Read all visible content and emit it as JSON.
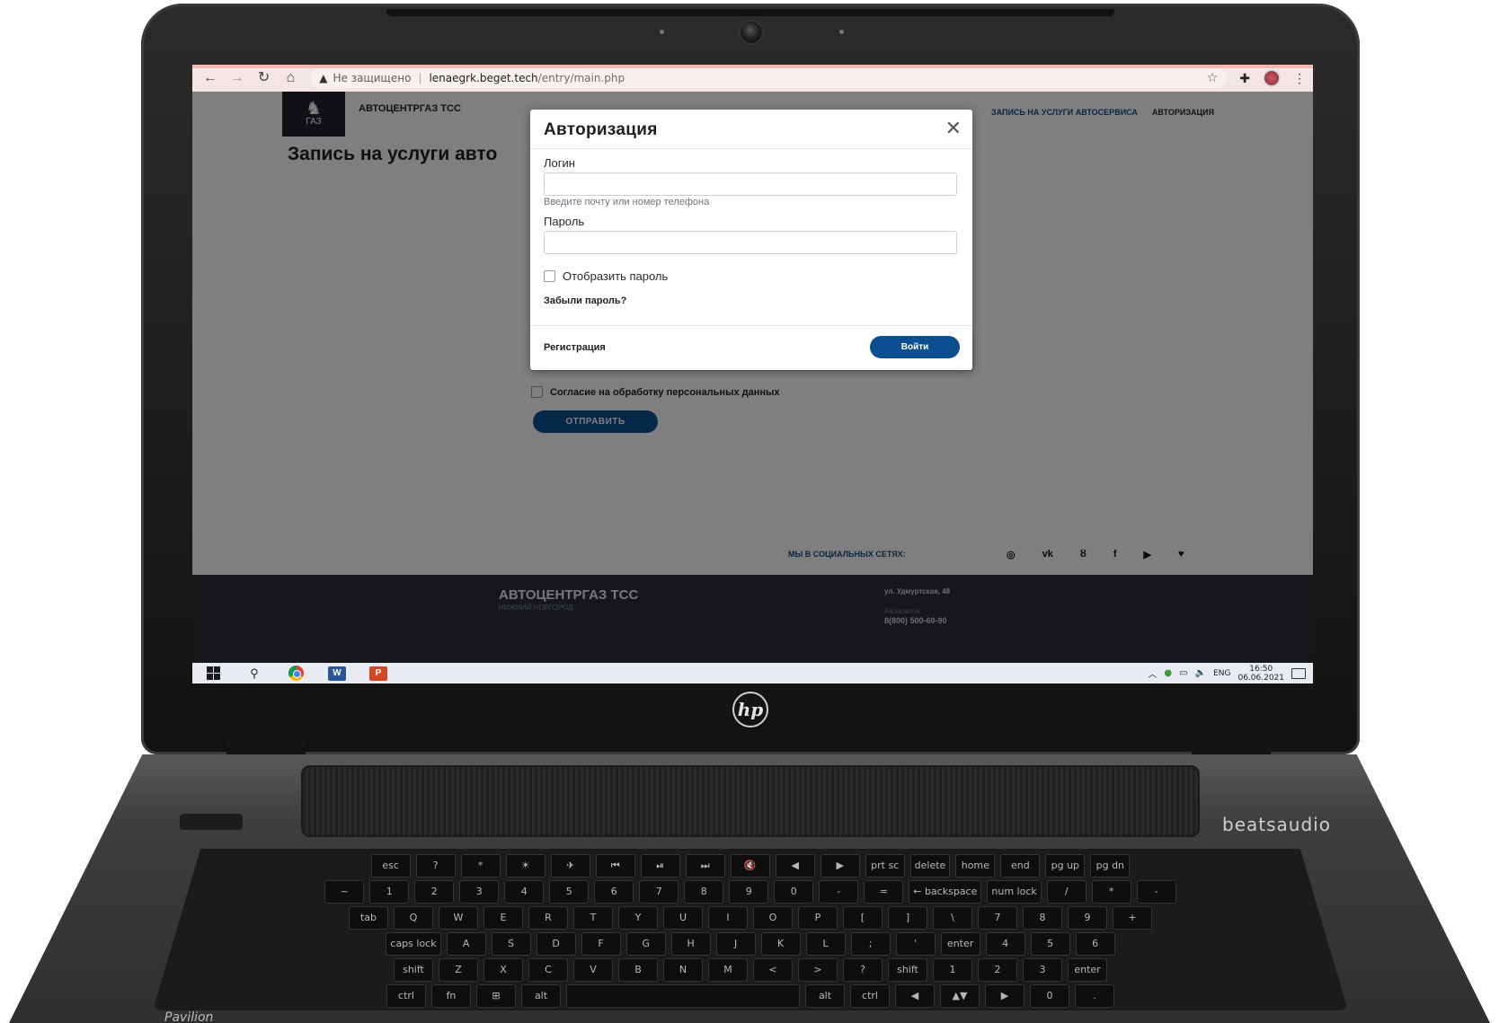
{
  "hardware": {
    "brand_logo": "hp",
    "beats_label": "beatsaudio",
    "model_label": "Pavilion",
    "keyboard_rows": [
      [
        "esc",
        "?",
        "*",
        "☀",
        "✈",
        "⏮",
        "⏯",
        "⏭",
        "🔇",
        "◀",
        "▶",
        "prt sc",
        "delete",
        "home",
        "end",
        "pg up",
        "pg dn"
      ],
      [
        "~",
        "1",
        "2",
        "3",
        "4",
        "5",
        "6",
        "7",
        "8",
        "9",
        "0",
        "-",
        "=",
        "← backspace",
        "num lock",
        "/",
        "*",
        "-"
      ],
      [
        "tab",
        "Q",
        "W",
        "E",
        "R",
        "T",
        "Y",
        "U",
        "I",
        "O",
        "P",
        "[",
        "]",
        "\\",
        "7",
        "8",
        "9",
        "+"
      ],
      [
        "caps lock",
        "A",
        "S",
        "D",
        "F",
        "G",
        "H",
        "J",
        "K",
        "L",
        ";",
        "'",
        "enter",
        "4",
        "5",
        "6"
      ],
      [
        "shift",
        "Z",
        "X",
        "C",
        "V",
        "B",
        "N",
        "M",
        "<",
        ">",
        "?",
        "shift",
        "1",
        "2",
        "3",
        "enter"
      ],
      [
        "ctrl",
        "fn",
        "⊞",
        "alt",
        "",
        "alt",
        "ctrl",
        "◀",
        "▲▼",
        "▶",
        "0",
        "."
      ]
    ]
  },
  "browser": {
    "warning_text": "Не защищено",
    "url_host": "lenaegrk.beget.tech",
    "url_path": "/entry/main.php",
    "icons": [
      "back-icon",
      "forward-icon",
      "reload-icon",
      "home-icon",
      "bookmark-star-icon",
      "extensions-icon",
      "profile-avatar",
      "menu-icon"
    ]
  },
  "site": {
    "logo_text": "ГАЗ",
    "brand": "АВТОЦЕНТРГАЗ ТСС",
    "nav": {
      "service": "ЗАПИСЬ НА УСЛУГИ АВТОСЕРВИСА",
      "auth": "АВТОРИЗАЦИЯ"
    },
    "heading": "Запись на услуги авто",
    "consent_label": "Согласие на обработку персональных данных",
    "submit_label": "ОТПРАВИТЬ",
    "social_title": "МЫ В СОЦИАЛЬНЫХ СЕТЯХ:",
    "social_icons": {
      "instagram": "◎",
      "vk": "vk",
      "ok": "ȣ",
      "facebook": "f",
      "youtube": "▶",
      "twitter": "♥"
    },
    "footer": {
      "brand": "АВТОЦЕНТРГАЗ ТСС",
      "city": "НИЖНИЙ НОВГОРОД",
      "address": "ул. Удмуртская, 48",
      "department": "Автосалон",
      "phone": "8(800) 500-60-90"
    }
  },
  "modal": {
    "title": "Авторизация",
    "login_label": "Логин",
    "login_value": "",
    "login_hint": "Введите почту или номер телефона",
    "password_label": "Пароль",
    "password_value": "",
    "show_password_label": "Отобразить пароль",
    "forgot_link": "Забыли пароль?",
    "register_link": "Регистрация",
    "login_button": "Войти"
  },
  "taskbar": {
    "apps": [
      "start-icon",
      "search-icon",
      "chrome-icon",
      "word-icon",
      "powerpoint-icon"
    ],
    "word_letter": "W",
    "ppt_letter": "P",
    "language": "ENG",
    "time": "16:50",
    "date": "06.06.2021"
  }
}
